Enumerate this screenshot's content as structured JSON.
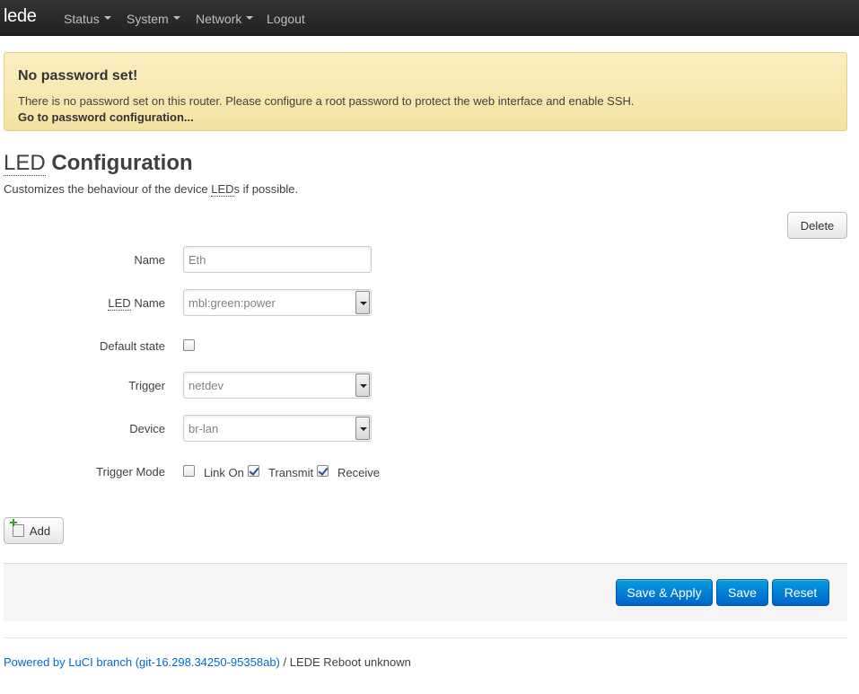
{
  "navbar": {
    "brand": "lede",
    "menu": [
      {
        "label": "Status"
      },
      {
        "label": "System"
      },
      {
        "label": "Network"
      },
      {
        "label": "Logout"
      }
    ]
  },
  "alert": {
    "title": "No password set!",
    "text": "There is no password set on this router. Please configure a root password to protect the web interface and enable SSH.",
    "link": "Go to password configuration..."
  },
  "page": {
    "title_abbr": "LED",
    "title_rest": "Configuration",
    "desc_before": "Customizes the behaviour of the device ",
    "desc_abbr": "LED",
    "desc_after": "s if possible."
  },
  "section": {
    "delete_label": "Delete",
    "add_label": "Add"
  },
  "form": {
    "name": {
      "label": "Name",
      "value": "Eth"
    },
    "led_name": {
      "label_abbr": "LED",
      "label_rest": " Name",
      "value": "mbl:green:power"
    },
    "default_state": {
      "label": "Default state",
      "checked": false
    },
    "trigger": {
      "label": "Trigger",
      "value": "netdev"
    },
    "device": {
      "label": "Device",
      "value": "br-lan"
    },
    "trigger_mode": {
      "label": "Trigger Mode",
      "options": [
        {
          "label": "Link On",
          "checked": false
        },
        {
          "label": "Transmit",
          "checked": true
        },
        {
          "label": "Receive",
          "checked": true
        }
      ]
    }
  },
  "actions": {
    "save_apply": "Save & Apply",
    "save": "Save",
    "reset": "Reset"
  },
  "footer": {
    "link": "Powered by LuCI branch (git-16.298.34250-95358ab)",
    "text": " / LEDE Reboot unknown"
  },
  "colors": {
    "navbar": "#222222",
    "alert_bg": "#f5e9b0",
    "primary": "#0064cd",
    "link": "#0069d6"
  }
}
